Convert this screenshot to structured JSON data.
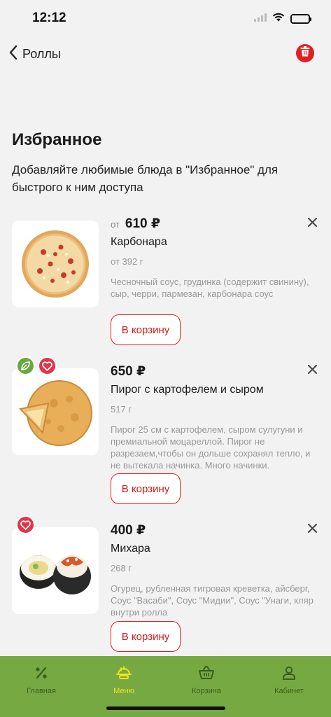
{
  "status": {
    "time": "12:12"
  },
  "nav": {
    "back_label": "Роллы"
  },
  "page": {
    "title": "Избранное",
    "subtitle": "Добавляйте любимые блюда в \"Избранное\" для быстрого к ним доступа"
  },
  "items": [
    {
      "price_prefix": "от",
      "price": "610 ₽",
      "name": "Карбонара",
      "weight": "от 392 г",
      "description": "Чесночный соус, грудинка (содержит свинину), сыр, черри, пармезан, карбонара соус",
      "cart_label": "В корзину"
    },
    {
      "price_prefix": "",
      "price": "650 ₽",
      "name": "Пирог с картофелем и сыром",
      "weight": "517 г",
      "description": "Пирог 25 см с картофелем, сыром сулугуни и премиальной моцареллой. Пирог не разрезаем,чтобы он дольше сохранял тепло, и не вытекала начинка. Много начинки.",
      "cart_label": "В корзину"
    },
    {
      "price_prefix": "",
      "price": "400 ₽",
      "name": "Михара",
      "weight": "268 г",
      "description": "Огурец, рубленная тигровая креветка, айсберг, Соус \"Васаби\", Соус \"Мидии\", Соус \"Унаги, кляр внутри ролла",
      "cart_label": "В корзину"
    }
  ],
  "tabbar": {
    "tabs": [
      {
        "label": "Главная",
        "icon": "percent-icon",
        "active": false
      },
      {
        "label": "Меню",
        "icon": "menu-icon",
        "active": true
      },
      {
        "label": "Корзина",
        "icon": "basket-icon",
        "active": false
      },
      {
        "label": "Кабинет",
        "icon": "user-icon",
        "active": false
      }
    ]
  },
  "colors": {
    "accent_red": "#e02020",
    "tabbar_green": "#76a942",
    "tab_active": "#f3e31a"
  }
}
